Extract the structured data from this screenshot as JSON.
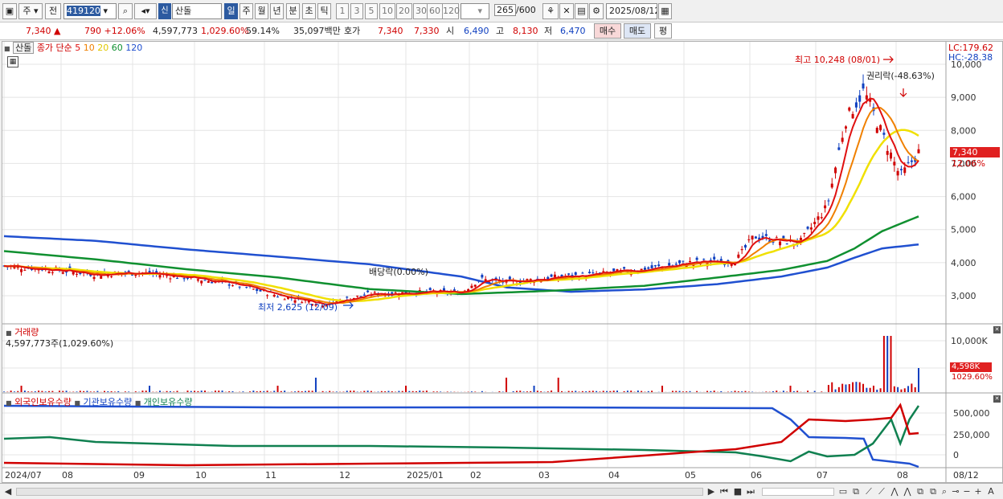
{
  "toolbar": {
    "market": "주",
    "kind": "전",
    "code": "419120",
    "stock_name": "산돌",
    "new_badge": "신",
    "periods": [
      "일",
      "주",
      "월",
      "년",
      "분",
      "초",
      "틱"
    ],
    "intervals": [
      "1",
      "3",
      "5",
      "10",
      "20",
      "30",
      "60",
      "120"
    ],
    "count": "265",
    "count_total": "/600",
    "date": "2025/08/12"
  },
  "quote": {
    "price": "7,340",
    "arrow": "▲",
    "change": "790",
    "change_pct": "+12.06%",
    "volume": "4,597,773",
    "vol_pct": "1,029.60%",
    "ratio": "59.14%",
    "amount": "35,097백만",
    "ask_label": "호가",
    "ask": "7,340",
    "bid": "7,330",
    "open_label": "시",
    "open": "6,490",
    "high_label": "고",
    "high": "8,130",
    "low_label": "저",
    "low": "6,470",
    "buy_btn": "매수",
    "sell_btn": "매도",
    "eval_btn": "평"
  },
  "price_panel": {
    "tab": "산돌",
    "legend_title": "종가 단순",
    "ma": [
      {
        "label": "5",
        "color": "#e01010"
      },
      {
        "label": "10",
        "color": "#f08000"
      },
      {
        "label": "20",
        "color": "#f0e000"
      },
      {
        "label": "60",
        "color": "#109030"
      },
      {
        "label": "120",
        "color": "#2050d0"
      }
    ],
    "lc": "LC:179.62",
    "hc": "HC:-28.38",
    "yticks": [
      "10,000",
      "9,000",
      "8,000",
      "7,000",
      "6,000",
      "5,000",
      "4,000",
      "3,000"
    ],
    "last_price": "7,340",
    "last_pct": "12.06%",
    "ann_high": "최고 10,248 (08/01)",
    "ann_rights": "권리락(-48.63%)",
    "ann_div": "배당락(0.00%)",
    "ann_low": "최저 2,625 (12/09)"
  },
  "volume_panel": {
    "title": "거래량",
    "value": "4,597,773주(1,029.60%)",
    "ytick": "10,000K",
    "last_vol": "4,598K",
    "last_pct": "1029.60%"
  },
  "holding_panel": {
    "labels": [
      {
        "text": "외국인보유수량",
        "color": "#d00000"
      },
      {
        "text": "기관보유수량",
        "color": "#1040c0"
      },
      {
        "text": "개인보유수량",
        "color": "#108050"
      }
    ],
    "yticks": [
      "500,000",
      "250,000",
      "0"
    ]
  },
  "xaxis": [
    "2024/07",
    "08",
    "09",
    "10",
    "11",
    "12",
    "2025/01",
    "02",
    "03",
    "04",
    "05",
    "06",
    "07",
    "08",
    "08/12"
  ],
  "chart_data": {
    "type": "line",
    "title": "산돌",
    "price_range": [
      2400,
      10600
    ],
    "ma120": [
      [
        0,
        4800
      ],
      [
        0.1,
        4660
      ],
      [
        0.2,
        4400
      ],
      [
        0.3,
        4180
      ],
      [
        0.4,
        3950
      ],
      [
        0.5,
        3580
      ],
      [
        0.55,
        3250
      ],
      [
        0.62,
        3120
      ],
      [
        0.7,
        3190
      ],
      [
        0.78,
        3350
      ],
      [
        0.85,
        3580
      ],
      [
        0.9,
        3850
      ],
      [
        0.93,
        4150
      ],
      [
        0.96,
        4430
      ],
      [
        1,
        4550
      ]
    ],
    "ma60": [
      [
        0,
        4350
      ],
      [
        0.1,
        4100
      ],
      [
        0.2,
        3800
      ],
      [
        0.3,
        3550
      ],
      [
        0.4,
        3200
      ],
      [
        0.5,
        3050
      ],
      [
        0.6,
        3150
      ],
      [
        0.7,
        3300
      ],
      [
        0.78,
        3550
      ],
      [
        0.85,
        3780
      ],
      [
        0.9,
        4050
      ],
      [
        0.93,
        4430
      ],
      [
        0.96,
        4950
      ],
      [
        1,
        5400
      ]
    ],
    "close": [
      [
        0,
        3900
      ],
      [
        0.05,
        3800
      ],
      [
        0.1,
        3650
      ],
      [
        0.15,
        3700
      ],
      [
        0.2,
        3550
      ],
      [
        0.25,
        3350
      ],
      [
        0.3,
        3000
      ],
      [
        0.35,
        2750
      ],
      [
        0.4,
        3050
      ],
      [
        0.45,
        3100
      ],
      [
        0.5,
        3100
      ],
      [
        0.52,
        3500
      ],
      [
        0.55,
        3400
      ],
      [
        0.6,
        3550
      ],
      [
        0.65,
        3650
      ],
      [
        0.7,
        3800
      ],
      [
        0.75,
        4000
      ],
      [
        0.8,
        4050
      ],
      [
        0.82,
        4800
      ],
      [
        0.85,
        4650
      ],
      [
        0.87,
        4600
      ],
      [
        0.9,
        5700
      ],
      [
        0.92,
        8300
      ],
      [
        0.94,
        9200
      ],
      [
        0.96,
        7900
      ],
      [
        0.98,
        6600
      ],
      [
        1,
        7340
      ]
    ],
    "highest": {
      "value": 10248,
      "date": "08/01"
    },
    "lowest": {
      "value": 2625,
      "date": "12/09"
    },
    "volume_last": "4,598K"
  }
}
